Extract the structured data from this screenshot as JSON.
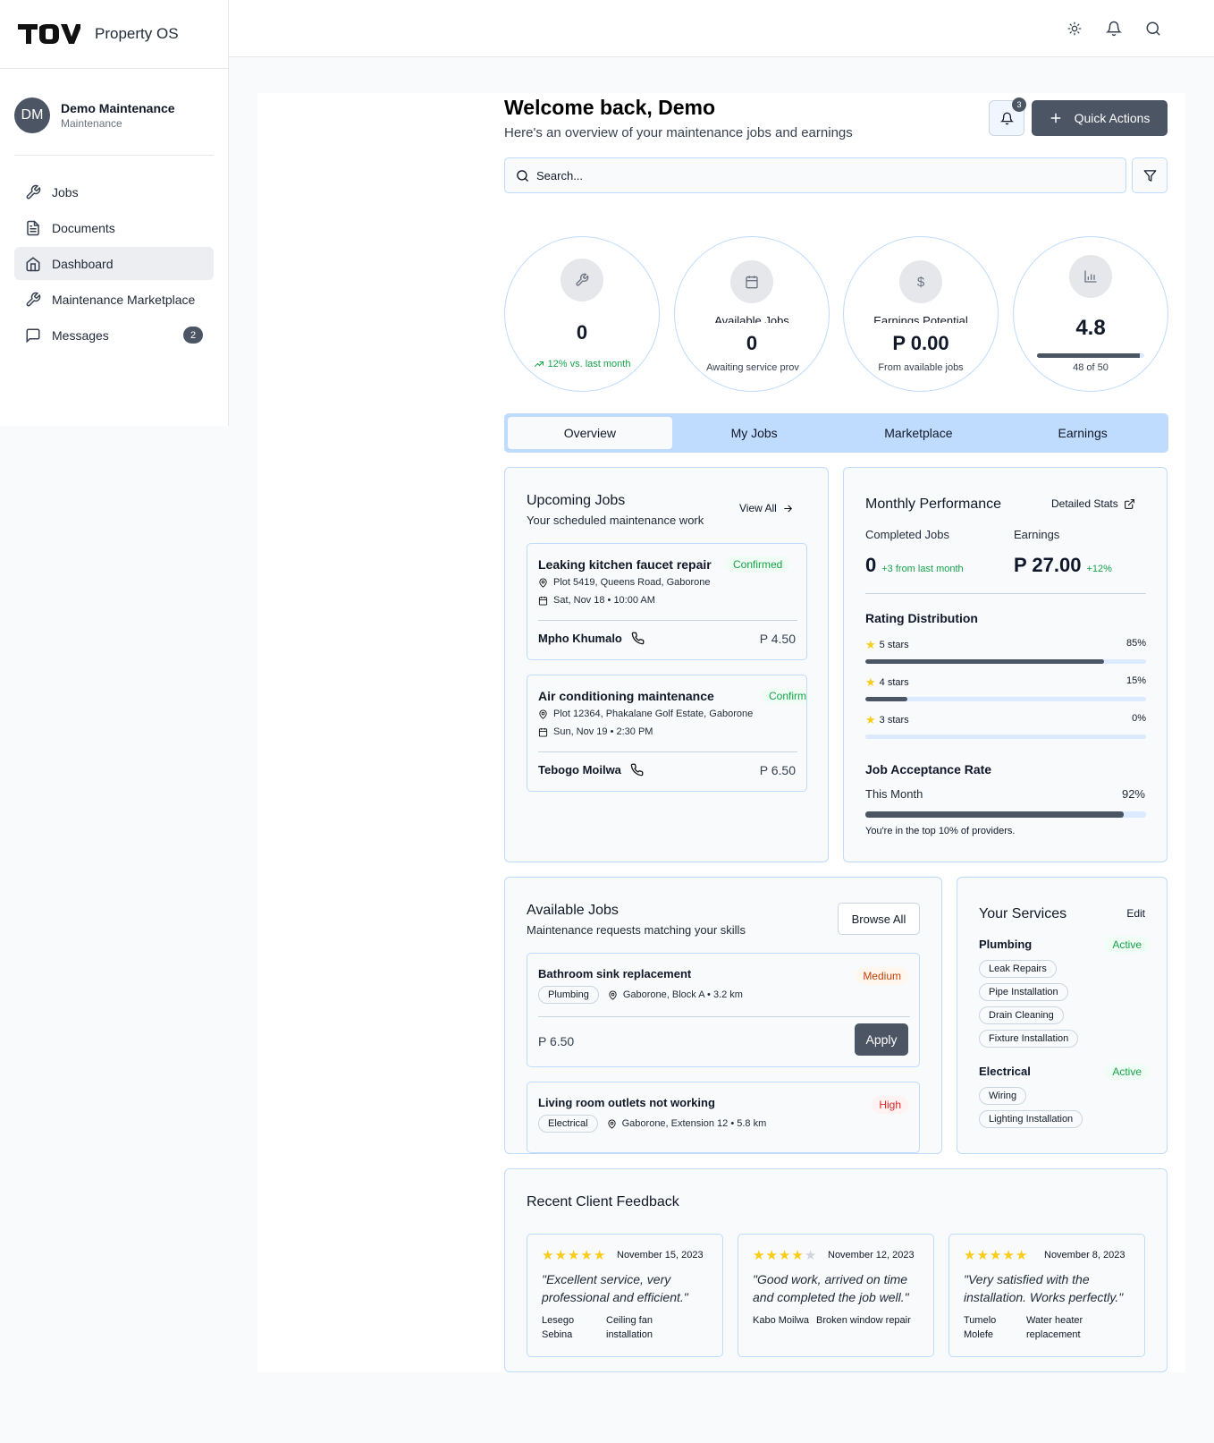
{
  "app": {
    "logo_text": "TOV",
    "name": "Property OS"
  },
  "user": {
    "initials": "DM",
    "name": "Demo Maintenance",
    "role": "Maintenance"
  },
  "nav": [
    {
      "label": "Jobs",
      "icon": "wrench-icon"
    },
    {
      "label": "Documents",
      "icon": "document-icon"
    },
    {
      "label": "Dashboard",
      "icon": "home-icon",
      "active": true
    },
    {
      "label": "Maintenance Marketplace",
      "icon": "wrench-icon"
    },
    {
      "label": "Messages",
      "icon": "message-icon",
      "badge": "2"
    }
  ],
  "topbar": {
    "icons": [
      "sun-icon",
      "bell-icon",
      "search-icon"
    ]
  },
  "header": {
    "title": "Welcome back, Demo",
    "subtitle": "Here's an overview of your maintenance jobs and earnings",
    "notification_count": "3",
    "quick_actions": "Quick Actions"
  },
  "search": {
    "placeholder": "Search..."
  },
  "stats": [
    {
      "icon": "wrench-icon",
      "value": "0",
      "trend": "12% vs. last month"
    },
    {
      "icon": "calendar-icon",
      "label": "Available Jobs",
      "value": "0",
      "sub": "Awaiting service prov"
    },
    {
      "icon": "dollar-icon",
      "label": "Earnings Potential",
      "value": "P 0.00",
      "sub": "From available jobs"
    },
    {
      "icon": "chart-icon",
      "value": "4.8",
      "sub": "48 of 50",
      "progress": 0.96
    }
  ],
  "tabs": [
    "Overview",
    "My Jobs",
    "Marketplace",
    "Earnings"
  ],
  "upcoming": {
    "title": "Upcoming Jobs",
    "subtitle": "Your scheduled maintenance work",
    "view_all": "View All",
    "jobs": [
      {
        "title": "Leaking kitchen faucet repair",
        "status": "Confirmed",
        "address": "Plot 5419, Queens Road, Gaborone",
        "when": "Sat, Nov 18 • 10:00 AM",
        "client": "Mpho Khumalo",
        "price": "P 4.50"
      },
      {
        "title": "Air conditioning maintenance",
        "status": "Confirm",
        "address": "Plot 12364, Phakalane Golf Estate, Gaborone",
        "when": "Sun, Nov 19 • 2:30 PM",
        "client": "Tebogo Moilwa",
        "price": "P 6.50"
      }
    ]
  },
  "performance": {
    "title": "Monthly Performance",
    "detailed": "Detailed Stats",
    "completed_label": "Completed Jobs",
    "completed_value": "0",
    "completed_delta": "+3 from last month",
    "earnings_label": "Earnings",
    "earnings_value": "P 27.00",
    "earnings_delta": "+12%",
    "rating_title": "Rating Distribution",
    "ratings": [
      {
        "label": "5 stars",
        "pct": "85%",
        "value": 85
      },
      {
        "label": "4 stars",
        "pct": "15%",
        "value": 15
      },
      {
        "label": "3 stars",
        "pct": "0%",
        "value": 0
      }
    ],
    "acceptance_title": "Job Acceptance Rate",
    "acceptance_label": "This Month",
    "acceptance_pct": "92%",
    "acceptance_value": 92,
    "acceptance_note": "You're in the top 10% of providers."
  },
  "available": {
    "title": "Available Jobs",
    "subtitle": "Maintenance requests matching your skills",
    "browse": "Browse All",
    "jobs": [
      {
        "title": "Bathroom sink replacement",
        "priority": "Medium",
        "category": "Plumbing",
        "location": "Gaborone, Block A • 3.2 km",
        "price": "P 6.50",
        "apply": "Apply"
      },
      {
        "title": "Living room outlets not working",
        "priority": "High",
        "category": "Electrical",
        "location": "Gaborone, Extension 12 • 5.8 km"
      }
    ]
  },
  "services": {
    "title": "Your Services",
    "edit": "Edit",
    "groups": [
      {
        "name": "Plumbing",
        "status": "Active",
        "items": [
          "Leak Repairs",
          "Pipe Installation",
          "Drain Cleaning",
          "Fixture Installation"
        ]
      },
      {
        "name": "Electrical",
        "status": "Active",
        "items": [
          "Wiring",
          "Lighting Installation"
        ]
      }
    ]
  },
  "feedback": {
    "title": "Recent Client Feedback",
    "items": [
      {
        "stars": 5,
        "date": "November 15, 2023",
        "quote": "\"Excellent service, very professional and efficient.\"",
        "client": "Lesego Sebina",
        "job": "Ceiling fan installation"
      },
      {
        "stars": 4,
        "date": "November 12, 2023",
        "quote": "\"Good work, arrived on time and completed the job well.\"",
        "client": "Kabo Moilwa",
        "job": "Broken window repair"
      },
      {
        "stars": 5,
        "date": "November 8, 2023",
        "quote": "\"Very satisfied with the installation. Works perfectly.\"",
        "client": "Tumelo Molefe",
        "job": "Water heater replacement"
      }
    ]
  },
  "colors": {
    "accent": "#4b5563",
    "border": "#bfdbfe",
    "success": "#16a34a",
    "star": "#facc15"
  }
}
